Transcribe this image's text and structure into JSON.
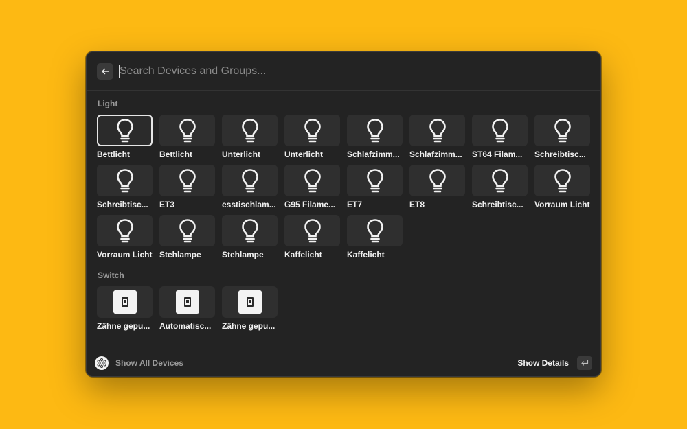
{
  "search": {
    "placeholder": "Search Devices and Groups..."
  },
  "sections": {
    "light": {
      "title": "Light",
      "items": [
        {
          "label": "Bettlicht"
        },
        {
          "label": "Bettlicht"
        },
        {
          "label": "Unterlicht"
        },
        {
          "label": "Unterlicht"
        },
        {
          "label": "Schlafzimm..."
        },
        {
          "label": "Schlafzimm..."
        },
        {
          "label": "ST64 Filam..."
        },
        {
          "label": "Schreibtisc..."
        },
        {
          "label": "Schreibtisc..."
        },
        {
          "label": "ET3"
        },
        {
          "label": "esstischlam..."
        },
        {
          "label": "G95 Filame..."
        },
        {
          "label": "ET7"
        },
        {
          "label": "ET8"
        },
        {
          "label": "Schreibtisc..."
        },
        {
          "label": "Vorraum Licht"
        },
        {
          "label": "Vorraum Licht"
        },
        {
          "label": "Stehlampe"
        },
        {
          "label": "Stehlampe"
        },
        {
          "label": "Kaffelicht"
        },
        {
          "label": "Kaffelicht"
        }
      ],
      "icon": "lightbulb-icon"
    },
    "switch": {
      "title": "Switch",
      "items": [
        {
          "label": "Zähne gepu..."
        },
        {
          "label": "Automatisc..."
        },
        {
          "label": "Zähne gepu..."
        }
      ],
      "icon": "switch-icon"
    }
  },
  "footer": {
    "left_label": "Show All Devices",
    "right_label": "Show Details"
  },
  "colors": {
    "background": "#FDB913",
    "panel": "#232323",
    "tile": "#2f2f2f"
  }
}
